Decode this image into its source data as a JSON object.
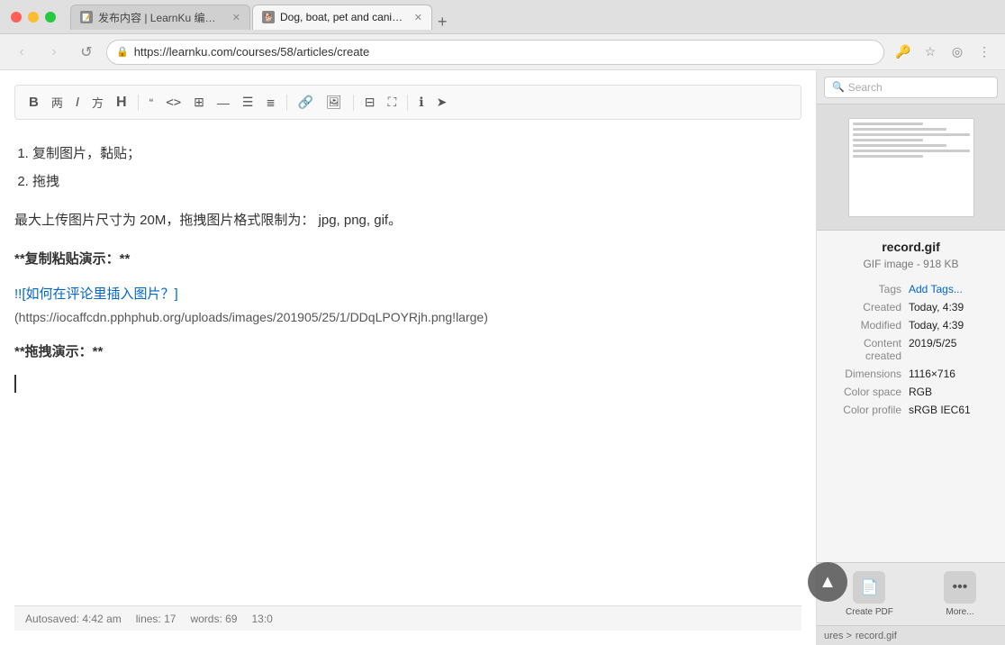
{
  "browser": {
    "tabs": [
      {
        "id": "tab1",
        "favicon": "📝",
        "label": "发布内容 | LearnKu 编程知识社",
        "active": false,
        "closeable": true
      },
      {
        "id": "tab2",
        "favicon": "🐕",
        "label": "Dog, boat, pet and canine | HD",
        "active": true,
        "closeable": true
      }
    ],
    "url": "https://learnku.com/courses/58/articles/create",
    "back_btn": "‹",
    "forward_btn": "›",
    "reload_btn": "↺",
    "menu_btn": "⋮"
  },
  "toolbar": {
    "buttons": [
      {
        "id": "bold",
        "label": "B",
        "type": "bold"
      },
      {
        "id": "italic-zh",
        "label": "两",
        "type": "text"
      },
      {
        "id": "italic",
        "label": "I",
        "type": "italic"
      },
      {
        "id": "heading",
        "label": "方",
        "type": "text"
      },
      {
        "id": "heading2",
        "label": "H",
        "type": "heading"
      },
      {
        "id": "sep1",
        "type": "separator"
      },
      {
        "id": "quote",
        "label": "❝",
        "type": "icon"
      },
      {
        "id": "code",
        "label": "<>",
        "type": "icon"
      },
      {
        "id": "table",
        "label": "⊞",
        "type": "icon"
      },
      {
        "id": "hr",
        "label": "—",
        "type": "icon"
      },
      {
        "id": "list-ul",
        "label": "☰",
        "type": "icon"
      },
      {
        "id": "list-ol",
        "label": "≡",
        "type": "icon"
      },
      {
        "id": "sep2",
        "type": "separator"
      },
      {
        "id": "link",
        "label": "🔗",
        "type": "icon"
      },
      {
        "id": "image",
        "label": "🖼",
        "type": "icon"
      },
      {
        "id": "sep3",
        "type": "separator"
      },
      {
        "id": "columns",
        "label": "⊟",
        "type": "icon"
      },
      {
        "id": "fullscreen",
        "label": "⛶",
        "type": "icon"
      },
      {
        "id": "sep4",
        "type": "separator"
      },
      {
        "id": "info",
        "label": "ℹ",
        "type": "icon"
      },
      {
        "id": "send",
        "label": "➤",
        "type": "icon"
      }
    ]
  },
  "editor": {
    "content": {
      "list_intro": [
        "复制图片，黏贴；",
        "拖拽"
      ],
      "note_text": "最大上传图片尺寸为 20M，拖拽图片格式限制为：  jpg, png, gif。",
      "section1_bold": "**复制粘贴演示：**",
      "link_text": "![如何在评论里插入图片？]",
      "link_url": "(https://iocaffcdn.pphphub.org/uploads/images/201905/25/1/DDqLPOYRjh.png!large)",
      "section2_bold": "**拖拽演示：**",
      "cursor_placeholder": ""
    },
    "status": {
      "autosave": "Autosaved: 4:42 am",
      "lines": "lines: 17",
      "words": "words: 69",
      "position": "13:0"
    }
  },
  "finder": {
    "search_placeholder": "Search",
    "filename": "record.gif",
    "filetype": "GIF image - 918 KB",
    "info": {
      "tags_label": "Tags",
      "tags_value": "Add Tags...",
      "created_label": "Created",
      "created_value": "Today, 4:39",
      "modified_label": "Modified",
      "modified_value": "Today, 4:39",
      "content_created_label": "Content created",
      "content_created_value": "2019/5/25",
      "dimensions_label": "Dimensions",
      "dimensions_value": "1116×716",
      "color_space_label": "Color space",
      "color_space_value": "RGB",
      "color_profile_label": "Color profile",
      "color_profile_value": "sRGB IEC61"
    },
    "actions": [
      {
        "id": "create-pdf",
        "icon": "📄",
        "label": "Create PDF"
      },
      {
        "id": "more",
        "icon": "⋯",
        "label": "More..."
      }
    ],
    "breadcrumb": {
      "path1": "ures >",
      "filename": "record.gif"
    }
  }
}
